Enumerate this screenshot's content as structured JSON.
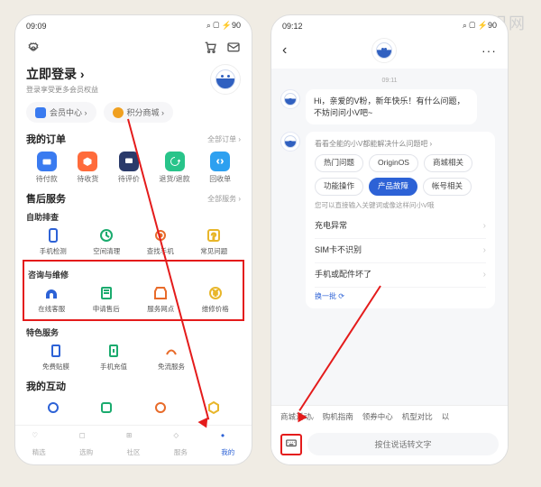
{
  "screens": {
    "left": {
      "status": {
        "time": "09:09",
        "icons": "◎ ▤ ⬙",
        "right": "⌕ ▢ ⚡90"
      },
      "topbar": {
        "gear": "⚙",
        "cart": "🛒",
        "msg": "✉"
      },
      "login": {
        "title": "立即登录 ›",
        "sub": "登录享受更多会员权益"
      },
      "pills": [
        {
          "icon_color": "#3a7bf0",
          "label": "会员中心 ›"
        },
        {
          "icon_color": "#f0a020",
          "label": "积分商城 ›"
        }
      ],
      "orders": {
        "title": "我的订单",
        "link": "全部订单 ›",
        "items": [
          {
            "bg": "#3a7bf0",
            "label": "待付款"
          },
          {
            "bg": "#ff6b3b",
            "label": "待收货"
          },
          {
            "bg": "#2a3a6a",
            "label": "待评价"
          },
          {
            "bg": "#28c48a",
            "label": "退货/退款"
          },
          {
            "bg": "#2da0f0",
            "label": "回收单"
          }
        ]
      },
      "aftersale": {
        "title": "售后服务",
        "link": "全部服务 ›",
        "group1_title": "自助排查",
        "group1": [
          {
            "label": "手机检测",
            "c": "#2d62d6"
          },
          {
            "label": "空间清理",
            "c": "#1aab6e"
          },
          {
            "label": "查找手机",
            "c": "#e86b2a"
          },
          {
            "label": "常见问题",
            "c": "#e8b62a"
          }
        ],
        "group2_title": "咨询与维修",
        "group2": [
          {
            "label": "在线客服",
            "c": "#2d62d6"
          },
          {
            "label": "申请售后",
            "c": "#1aab6e"
          },
          {
            "label": "服务网点",
            "c": "#e86b2a"
          },
          {
            "label": "维修价格",
            "c": "#e8b62a"
          }
        ],
        "group3_title": "特色服务",
        "group3": [
          {
            "label": "免费贴膜",
            "c": "#2d62d6"
          },
          {
            "label": "手机充值",
            "c": "#1aab6e"
          },
          {
            "label": "免流服务",
            "c": "#e86b2a"
          }
        ]
      },
      "interact": {
        "title": "我的互动"
      },
      "nav": [
        {
          "label": "精选"
        },
        {
          "label": "选购"
        },
        {
          "label": "社区"
        },
        {
          "label": "服务"
        },
        {
          "label": "我的",
          "active": true
        }
      ]
    },
    "right": {
      "status": {
        "time": "09:12",
        "icons": "◎ ▤ ⬙",
        "right": "⌕ ▢ ⚡90"
      },
      "header": {
        "back": "‹",
        "more": "···"
      },
      "time_label": "09:11",
      "greeting": "Hi，亲爱的V粉，新年快乐！有什么问题，不妨问问小V吧~",
      "chip_card": {
        "head": "看看全能的小V都能解决什么问题吧 ›",
        "chips": [
          "热门问题",
          "OriginOS",
          "商城相关",
          "功能操作",
          "产品故障",
          "帐号相关"
        ],
        "active_index": 4,
        "faq_hint": "您可以直接输入关键词或像这样问小V哦",
        "faqs": [
          "充电异常",
          "SIM卡不识别",
          "手机或配件坏了"
        ],
        "more": "换一批 ⟳"
      },
      "quick": [
        "商城活动ᵥ",
        "购机指南",
        "领券中心",
        "机型对比",
        "以"
      ],
      "input": {
        "kb": "⌨",
        "voice": "按住说话转文字"
      }
    }
  }
}
